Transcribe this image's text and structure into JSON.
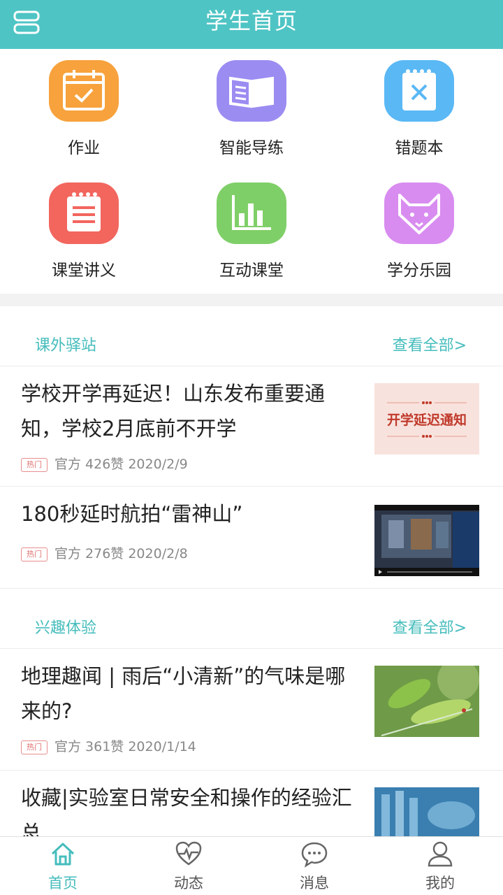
{
  "header": {
    "title": "学生首页",
    "menu_icon": "menu-icon"
  },
  "grid": [
    {
      "label": "作业",
      "icon": "calendar-check-icon",
      "color": "#f7a23c"
    },
    {
      "label": "智能导练",
      "icon": "book-icon",
      "color": "#9b8cf2"
    },
    {
      "label": "错题本",
      "icon": "notebook-x-icon",
      "color": "#5ab8f5"
    },
    {
      "label": "课堂讲义",
      "icon": "notes-icon",
      "color": "#f2665e"
    },
    {
      "label": "互动课堂",
      "icon": "bar-chart-icon",
      "color": "#7fcf68"
    },
    {
      "label": "学分乐园",
      "icon": "fox-icon",
      "color": "#d88cf0"
    }
  ],
  "sections": [
    {
      "title": "课外驿站",
      "more": "查看全部>",
      "articles": [
        {
          "title": "学校开学再延迟！山东发布重要通知，学校2月底前不开学",
          "badge": "热门",
          "meta": "官方 426赞 2020/2/9",
          "thumb_text": "开学延迟通知"
        },
        {
          "title": "180秒延时航拍“雷神山”",
          "badge": "热门",
          "meta": "官方 276赞 2020/2/8"
        }
      ]
    },
    {
      "title": "兴趣体验",
      "more": "查看全部>",
      "articles": [
        {
          "title": "地理趣闻 | 雨后“小清新”的气味是哪来的?",
          "badge": "热门",
          "meta": "官方 361赞 2020/1/14"
        },
        {
          "title": "收藏|实验室日常安全和操作的经验汇总"
        }
      ]
    }
  ],
  "tabbar": [
    {
      "label": "首页",
      "icon": "home-icon",
      "active": true
    },
    {
      "label": "动态",
      "icon": "heart-pulse-icon",
      "active": false
    },
    {
      "label": "消息",
      "icon": "chat-bubble-icon",
      "active": false
    },
    {
      "label": "我的",
      "icon": "user-icon",
      "active": false
    }
  ],
  "colors": {
    "accent": "#4fc4c4",
    "badge": "#e07070"
  }
}
